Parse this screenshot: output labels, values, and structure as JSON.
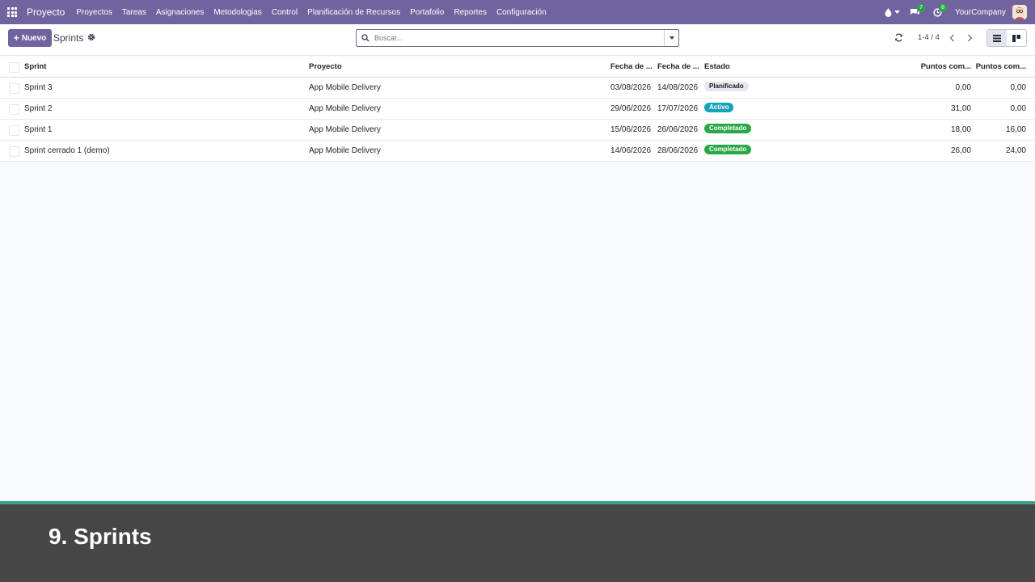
{
  "navbar": {
    "app_title": "Proyecto",
    "menu": [
      "Proyectos",
      "Tareas",
      "Asignaciones",
      "Metodologias",
      "Control",
      "Planificación de Recursos",
      "Portafolio",
      "Reportes",
      "Configuración"
    ],
    "messages_count": "7",
    "activities_count": "8",
    "company": "YourCompany"
  },
  "control_panel": {
    "new_label": "Nuevo",
    "breadcrumb": "Sprints",
    "search_placeholder": "Buscar...",
    "pager": "1-4 / 4"
  },
  "list": {
    "columns": [
      "Sprint",
      "Proyecto",
      "Fecha de ...",
      "Fecha de ...",
      "Estado",
      "Puntos com...",
      "Puntos com..."
    ],
    "rows": [
      {
        "sprint": "Sprint 3",
        "project": "App Mobile Delivery",
        "start": "03/08/2026",
        "end": "14/08/2026",
        "status": "Planificado",
        "points_committed": "0,00",
        "points_completed": "0,00"
      },
      {
        "sprint": "Sprint 2",
        "project": "App Mobile Delivery",
        "start": "29/06/2026",
        "end": "17/07/2026",
        "status": "Activo",
        "points_committed": "31,00",
        "points_completed": "0,00"
      },
      {
        "sprint": "Sprint 1",
        "project": "App Mobile Delivery",
        "start": "15/06/2026",
        "end": "26/06/2026",
        "status": "Completado",
        "points_committed": "18,00",
        "points_completed": "16,00"
      },
      {
        "sprint": "Sprint cerrado 1 (demo)",
        "project": "App Mobile Delivery",
        "start": "14/06/2026",
        "end": "28/06/2026",
        "status": "Completado",
        "points_committed": "26,00",
        "points_completed": "24,00"
      }
    ]
  },
  "status_colors": {
    "Planificado": {
      "bg": "#e5e7eb",
      "fg": "#111827"
    },
    "Activo": {
      "bg": "#17a2b8",
      "fg": "#ffffff"
    },
    "Completado": {
      "bg": "#28a745",
      "fg": "#ffffff"
    }
  },
  "colors": {
    "brand": "#71639e",
    "footer_bg": "#464646",
    "footer_accent": "#3aa08f"
  },
  "footer": {
    "caption": "9. Sprints"
  }
}
